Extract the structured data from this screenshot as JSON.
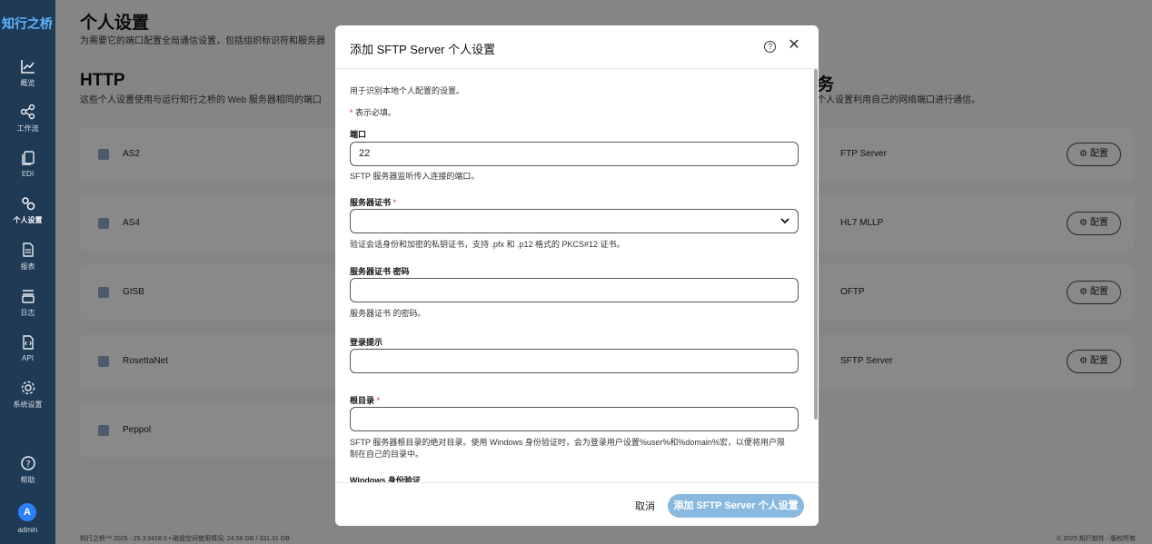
{
  "brand": "知行之桥",
  "nav": [
    {
      "label": "概览",
      "icon": "chart-line-icon"
    },
    {
      "label": "工作流",
      "icon": "workflow-icon"
    },
    {
      "label": "EDI",
      "icon": "documents-icon"
    },
    {
      "label": "个人设置",
      "icon": "gears-icon"
    },
    {
      "label": "报表",
      "icon": "report-icon"
    },
    {
      "label": "日志",
      "icon": "log-icon"
    },
    {
      "label": "API",
      "icon": "api-icon"
    },
    {
      "label": "系统设置",
      "icon": "settings-gear-icon"
    },
    {
      "label": "帮助",
      "icon": "help-circle-icon"
    }
  ],
  "user": {
    "initial": "A",
    "name": "admin"
  },
  "page": {
    "title": "个人设置",
    "subtitle": "为需要它的端口配置全局通信设置，包括组织标识符和服务器"
  },
  "http": {
    "title": "HTTP",
    "subtitle": "这些个人设置使用与运行知行之桥的 Web 服务器相同的端口"
  },
  "right_section": {
    "title_fragment": "务",
    "subtitle": "个人设置利用自己的网络端口进行通信。"
  },
  "left_cards": [
    "AS2",
    "AS4",
    "GISB",
    "RosettaNet",
    "Peppol"
  ],
  "right_cards": [
    "FTP Server",
    "HL7 MLLP",
    "OFTP",
    "SFTP Server"
  ],
  "configure_label": "配置",
  "footer": {
    "left": "知行之桥™ 2025 - 25.3.9418.0  •  磁盘空间使用情况:  24.56 GB / 331.31 GB",
    "right": "© 2025 知行软件 - 版权所有"
  },
  "modal": {
    "title": "添加 SFTP Server 个人设置",
    "intro": "用于识别本地个人配置的设置。",
    "required_note": "表示必填。",
    "port": {
      "label": "端口",
      "value": "22",
      "help": "SFTP 服务器监听传入连接的端口。"
    },
    "cert": {
      "label": "服务器证书",
      "value": "",
      "help": "验证会话身份和加密的私钥证书，支持 .pfx 和 .p12 格式的 PKCS#12 证书。"
    },
    "cert_password": {
      "label": "服务器证书 密码",
      "value": "",
      "help": "服务器证书 的密码。"
    },
    "login_prompt": {
      "label": "登录提示",
      "value": ""
    },
    "root_dir": {
      "label": "根目录",
      "value": "",
      "help_line1": "SFTP 服务器根目录的绝对目录。使用 Windows 身份验证时，会为登录用户设置%user%和%domain%宏，以便将用户限",
      "help_line2": "制在自己的目录中。"
    },
    "windows_auth": {
      "label": "Windows 身份验证"
    },
    "cancel_label": "取消",
    "submit_label": "添加 SFTP Server 个人设置"
  }
}
